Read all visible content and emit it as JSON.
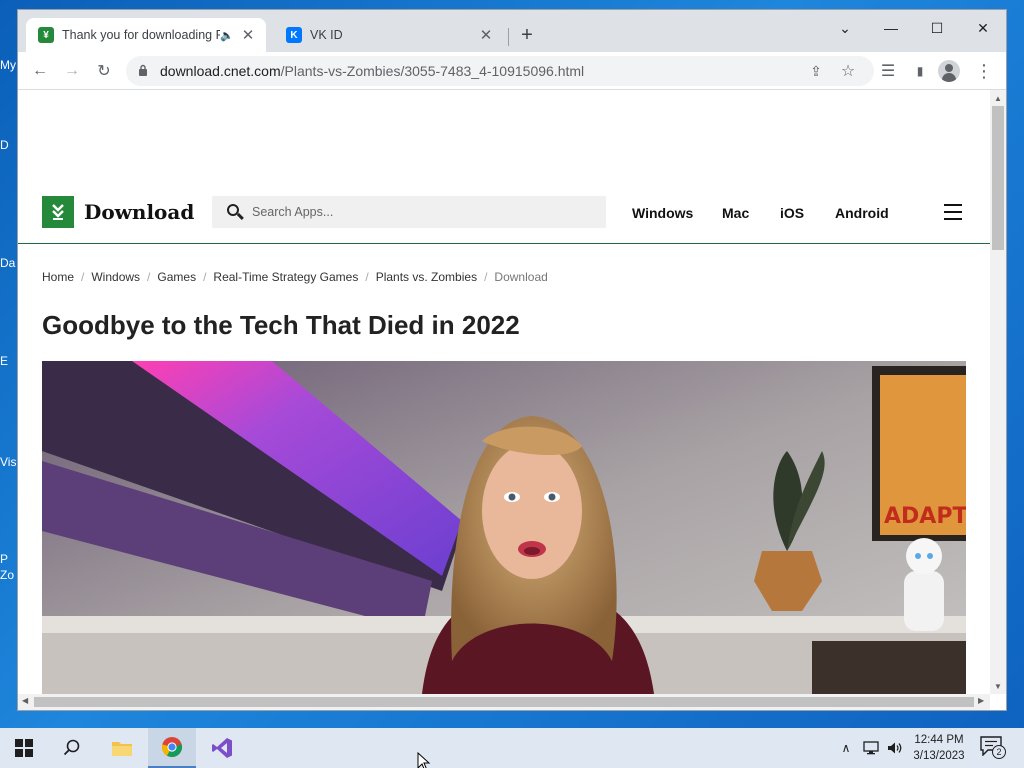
{
  "desktop": {
    "labels": [
      "My",
      "D",
      "Da",
      "E",
      "Vis",
      "P",
      "Zo"
    ]
  },
  "browser": {
    "tabs": [
      {
        "title": "Thank you for downloading Plants vs. Zombies",
        "favicon": "download-favicon",
        "playing_audio": true,
        "close": "✕"
      },
      {
        "title": "VK ID",
        "favicon": "vk-favicon",
        "close": "✕"
      }
    ],
    "new_tab": "+",
    "window_controls": {
      "tab_search": "⌄",
      "minimize": "—",
      "maximize": "☐",
      "close": "✕"
    },
    "toolbar": {
      "back": "←",
      "forward": "→",
      "reload": "↻",
      "url_host": "download.cnet.com",
      "url_path": "/Plants-vs-Zombies/3055-7483_4-10915096.html",
      "share": "⇪",
      "bookmark": "☆",
      "reading_list": "☰",
      "side_panel": "▮",
      "menu": "⋮"
    }
  },
  "site": {
    "logo_text": "Download",
    "search_placeholder": "Search Apps...",
    "nav": [
      "Windows",
      "Mac",
      "iOS",
      "Android"
    ]
  },
  "breadcrumb": [
    "Home",
    "Windows",
    "Games",
    "Real-Time Strategy Games",
    "Plants vs. Zombies",
    "Download"
  ],
  "headline": "Goodbye to the Tech That Died in 2022",
  "video": {
    "poster_text": "ADAPT"
  },
  "taskbar": {
    "clock_time": "12:44 PM",
    "clock_date": "3/13/2023",
    "notifications": "2",
    "apps": [
      "start",
      "search",
      "file-explorer",
      "chrome",
      "visual-studio"
    ]
  },
  "colors": {
    "brand_green": "#24893b",
    "taskbar": "#dfe8f2",
    "desktop_blue": "#1e86dc"
  }
}
